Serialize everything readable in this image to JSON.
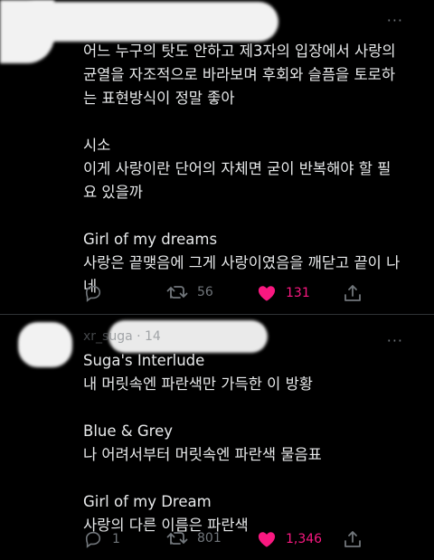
{
  "tweets": [
    {
      "paragraphs": [
        "어느 누구의 탓도 안하고 제3자의 입장에서 사랑의\n균열을 자조적으로 바라보며 후회와 슬픔을 토로하\n는 표현방식이 정말 좋아",
        "시소\n이게 사랑이란 단어의 자체면 굳이 반복해야 할 필\n요 있을까",
        "Girl of my dreams\n사랑은 끝맺음에 그게 사랑이였음을 깨닫고 끝이 나\n네"
      ],
      "retweets": "56",
      "likes": "131",
      "replies": ""
    },
    {
      "header": "xr_suga · 14",
      "paragraphs": [
        "Suga's Interlude\n내 머릿속엔 파란색만 가득한 이 방황",
        "Blue & Grey\n나 어려서부터 머릿속엔 파란색 물음표",
        "Girl of my Dream\n사랑의 다른 이름은 파란색"
      ],
      "replies": "1",
      "retweets": "801",
      "likes": "1,346"
    }
  ],
  "icons": {
    "reply": "reply-icon",
    "retweet": "retweet-icon",
    "like": "heart-icon",
    "share": "share-icon",
    "more": "more-icon"
  },
  "colors": {
    "like": "#f91880",
    "muted": "#71767b",
    "text": "#e7e9ea",
    "bg": "#000000"
  }
}
